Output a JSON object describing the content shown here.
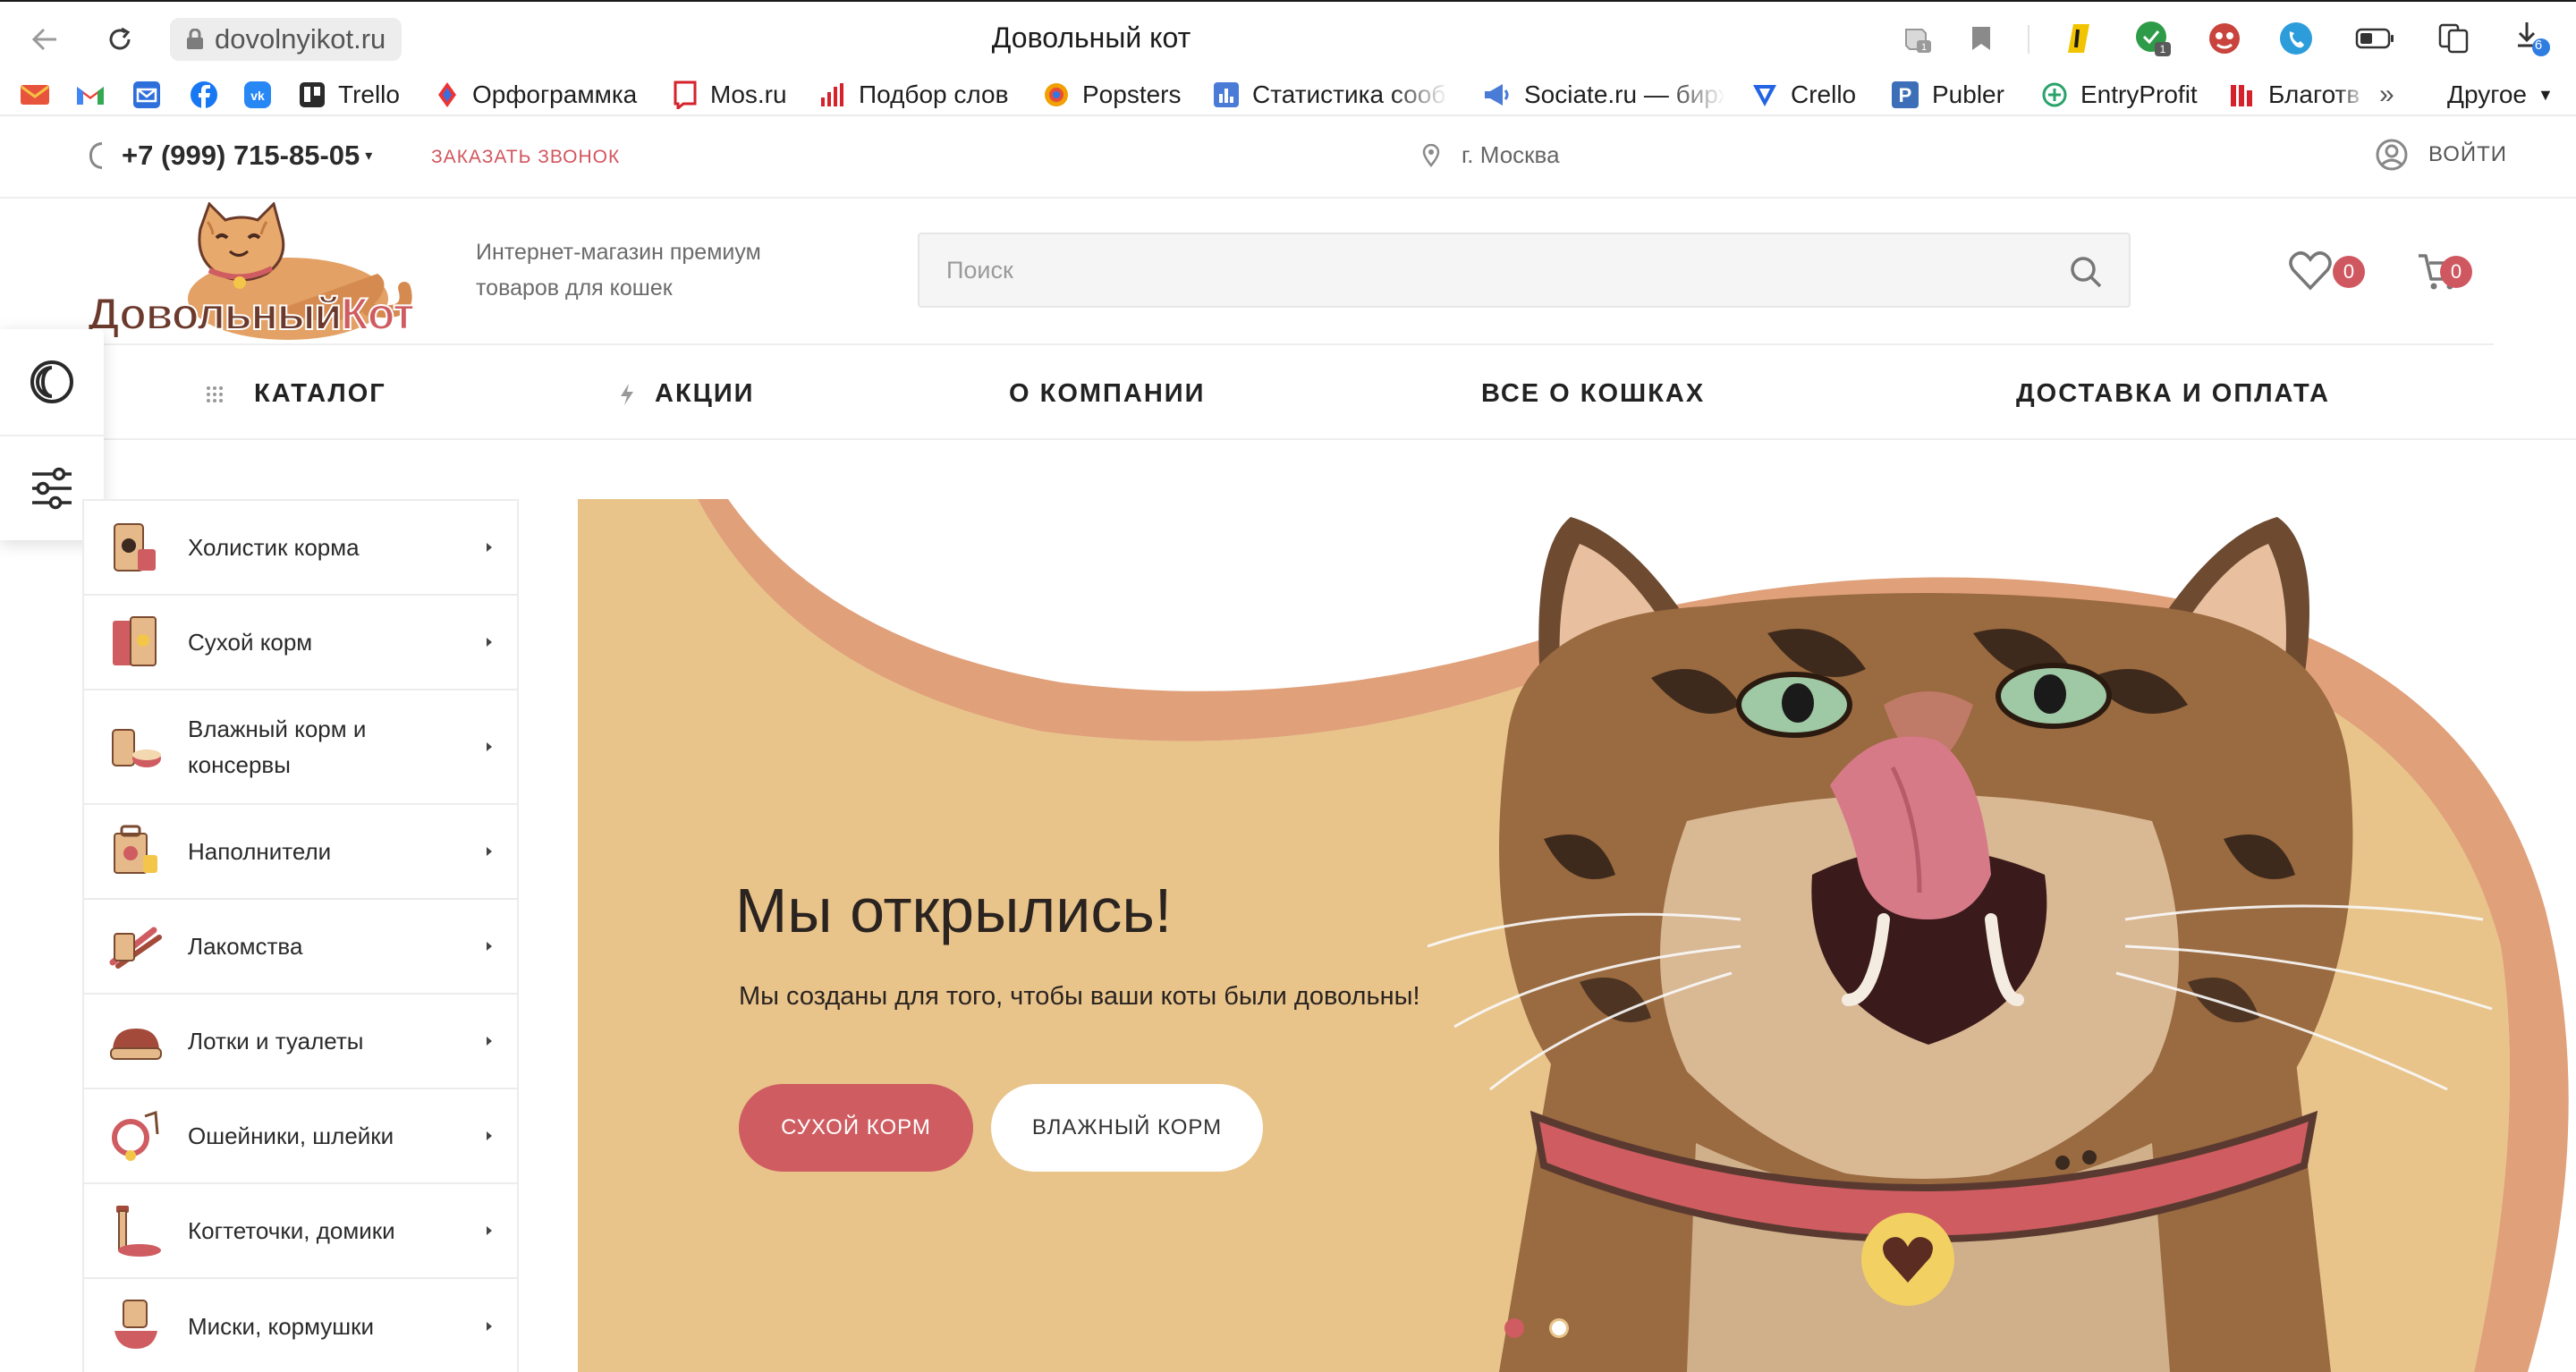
{
  "browser": {
    "url": "dovolnyikot.ru",
    "title": "Довольный кот",
    "download_badge": "6",
    "ext_badge_1": "1",
    "ext_badge_2": "1",
    "bookmarks": [
      {
        "label": "",
        "color": "#e8543b",
        "icon": "mail-icon"
      },
      {
        "label": "",
        "color": "#ea4335",
        "icon": "gmail-icon"
      },
      {
        "label": "",
        "color": "#2f6fdc",
        "icon": "mailbox-icon"
      },
      {
        "label": "",
        "color": "#1877f2",
        "icon": "facebook-icon"
      },
      {
        "label": "",
        "color": "#2787f5",
        "icon": "vk-icon"
      },
      {
        "label": "Trello",
        "color": "#2b2b2b",
        "icon": "trello-icon"
      },
      {
        "label": "Орфограммка",
        "color": "#3b6fe0",
        "icon": "orfogrammka-icon"
      },
      {
        "label": "Mos.ru",
        "color": "#d6222b",
        "icon": "mos-icon"
      },
      {
        "label": "Подбор слов",
        "color": "#d6222b",
        "icon": "bars-icon"
      },
      {
        "label": "Popsters",
        "color": "#f0a000",
        "icon": "popsters-icon"
      },
      {
        "label": "Статистика сооб",
        "color": "#4a7bd6",
        "icon": "stats-icon"
      },
      {
        "label": "Sociate.ru — бирж",
        "color": "#4a7bd6",
        "icon": "megaphone-icon"
      },
      {
        "label": "Crello",
        "color": "#2364e3",
        "icon": "crello-icon"
      },
      {
        "label": "Publer",
        "color": "#3c6fb8",
        "icon": "publer-icon"
      },
      {
        "label": "EntryProfit",
        "color": "#2aa36a",
        "icon": "entryprofit-icon"
      },
      {
        "label": "Благотв",
        "color": "#d6222b",
        "icon": "charity-icon"
      }
    ],
    "more_label": "»",
    "other_label": "Другое"
  },
  "topline": {
    "phone": "+7 (999) 715-85-05",
    "callback": "ЗАКАЗАТЬ ЗВОНОК",
    "city": "г. Москва",
    "login": "ВОЙТИ"
  },
  "header": {
    "logo_text_1": "Довольный",
    "logo_text_2": "Кот",
    "tagline_1": "Интернет-магазин премиум",
    "tagline_2": "товаров для кошек",
    "search_placeholder": "Поиск",
    "favorites_count": "0",
    "cart_count": "0"
  },
  "nav": [
    {
      "label": "КАТАЛОГ"
    },
    {
      "label": "АКЦИИ"
    },
    {
      "label": "О КОМПАНИИ"
    },
    {
      "label": "ВСЕ О КОШКАХ"
    },
    {
      "label": "ДОСТАВКА И ОПЛАТА"
    }
  ],
  "categories": [
    {
      "label": "Холистик корма"
    },
    {
      "label": "Сухой корм"
    },
    {
      "label": "Влажный корм и консервы"
    },
    {
      "label": "Наполнители"
    },
    {
      "label": "Лакомства"
    },
    {
      "label": "Лотки и туалеты"
    },
    {
      "label": "Ошейники, шлейки"
    },
    {
      "label": "Когтеточки, домики"
    },
    {
      "label": "Миски, кормушки"
    }
  ],
  "hero": {
    "title": "Мы открылись!",
    "subtitle": "Мы созданы для того, чтобы ваши коты были довольны!",
    "btn_dry": "СУХОЙ КОРМ",
    "btn_wet": "ВЛАЖНЫЙ КОРМ",
    "slides_total": 2,
    "active_slide": 1
  },
  "colors": {
    "accent": "#cf5c61",
    "hero_bg": "#e8c48b",
    "hero_wave": "#e0a07a"
  }
}
